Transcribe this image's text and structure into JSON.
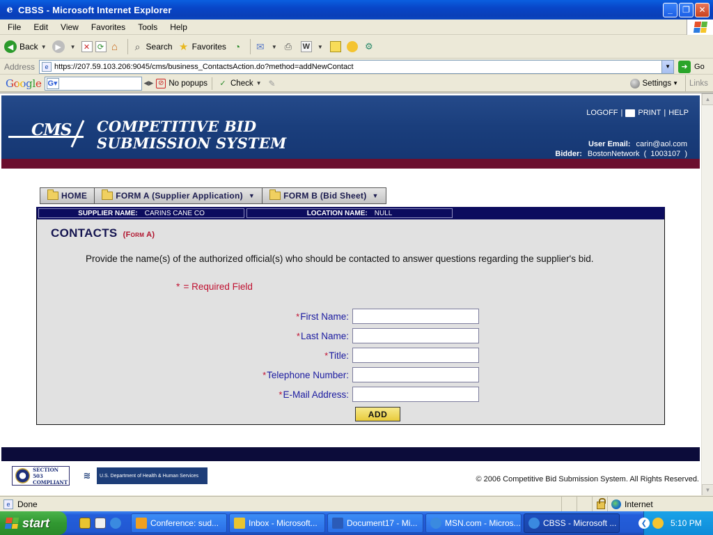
{
  "window": {
    "title": "CBSS - Microsoft Internet Explorer",
    "buttons": {
      "minimize": "_",
      "maximize": "❐",
      "close": "✕"
    }
  },
  "menubar": {
    "items": [
      "File",
      "Edit",
      "View",
      "Favorites",
      "Tools",
      "Help"
    ]
  },
  "toolbar": {
    "back": "Back",
    "search": "Search",
    "favorites": "Favorites"
  },
  "addressbar": {
    "label": "Address",
    "url": "https://207.59.103.206:9045/cms/business_ContactsAction.do?method=addNewContact",
    "go": "Go"
  },
  "googlebar": {
    "logo": "Google",
    "search_value": "",
    "popups": "No popups",
    "check": "Check",
    "settings": "Settings",
    "links": "Links"
  },
  "header": {
    "logo": "CMS",
    "title_line1": "COMPETITIVE BID",
    "title_line2": "SUBMISSION SYSTEM",
    "logoff": "LOGOFF",
    "print": "PRINT",
    "help": "HELP",
    "user_email_label": "User Email:",
    "user_email": "carin@aol.com",
    "bidder_label": "Bidder:",
    "bidder_value": "BostonNetwork  (  1003107  )"
  },
  "nav": {
    "tabs": [
      {
        "label": "HOME",
        "has_dropdown": false
      },
      {
        "label": "FORM A (Supplier Application)",
        "has_dropdown": true
      },
      {
        "label": "FORM B (Bid Sheet)",
        "has_dropdown": true
      }
    ]
  },
  "info_strip": {
    "supplier_label": "SUPPLIER NAME:",
    "supplier_value": "CARINS CANE CO",
    "location_label": "LOCATION NAME:",
    "location_value": "NULL"
  },
  "form": {
    "title": "CONTACTS",
    "subtitle": "(Form A)",
    "instructions": "Provide the name(s) of the authorized official(s) who should be contacted to answer questions regarding the supplier's bid.",
    "required_note": "= Required Field",
    "required_marker": "*",
    "fields": [
      {
        "label": "First Name:",
        "value": ""
      },
      {
        "label": "Last Name:",
        "value": ""
      },
      {
        "label": "Title:",
        "value": ""
      },
      {
        "label": "Telephone Number:",
        "value": ""
      },
      {
        "label": "E-Mail Address:",
        "value": ""
      }
    ],
    "submit_label": "ADD"
  },
  "footer": {
    "section503_line1": "SECTION 503",
    "section503_line2": "COMPLIANT",
    "hhs_text": "U.S. Department of Health & Human Services",
    "copyright": "© 2006 Competitive Bid Submission System. All Rights Reserved."
  },
  "statusbar": {
    "status": "Done",
    "zone": "Internet"
  },
  "taskbar": {
    "start": "start",
    "tasks": [
      {
        "label": "Conference: sud...",
        "active": false,
        "icon_color": "#f0a020"
      },
      {
        "label": "Inbox - Microsoft...",
        "active": false,
        "icon_color": "#e8c430"
      },
      {
        "label": "Document17 - Mi...",
        "active": false,
        "icon_color": "#2b5bb8"
      },
      {
        "label": "MSN.com - Micros...",
        "active": false,
        "icon_color": "#3a8ae0"
      },
      {
        "label": "CBSS - Microsoft ...",
        "active": true,
        "icon_color": "#3a8ae0"
      }
    ],
    "clock": "5:10 PM"
  }
}
